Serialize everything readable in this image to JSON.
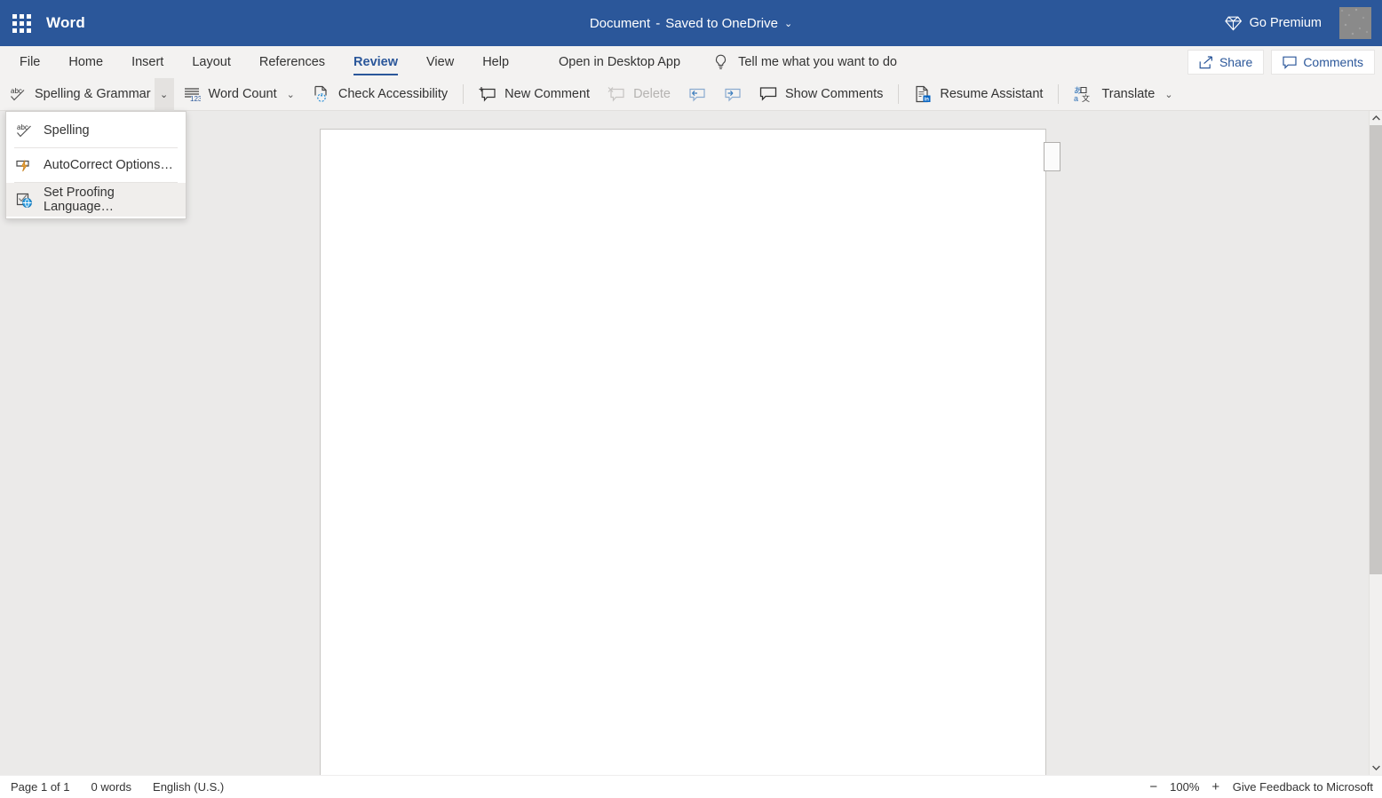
{
  "titlebar": {
    "app_name": "Word",
    "waffle_icon": "app-launcher-icon",
    "document_name": "Document",
    "separator": "-",
    "save_status": "Saved to OneDrive",
    "title_chevron": "⌄",
    "go_premium": "Go Premium",
    "premium_icon": "diamond-icon",
    "avatar_icon": "user-avatar",
    "brand_color": "#2b579a"
  },
  "tabs": [
    {
      "label": "File",
      "active": false
    },
    {
      "label": "Home",
      "active": false
    },
    {
      "label": "Insert",
      "active": false
    },
    {
      "label": "Layout",
      "active": false
    },
    {
      "label": "References",
      "active": false
    },
    {
      "label": "Review",
      "active": true
    },
    {
      "label": "View",
      "active": false
    },
    {
      "label": "Help",
      "active": false
    }
  ],
  "tabbar": {
    "open_desktop": "Open in Desktop App",
    "tellme_icon": "lightbulb-icon",
    "tellme": "Tell me what you want to do",
    "share_label": "Share",
    "share_icon": "share-icon",
    "comments_label": "Comments",
    "comments_icon": "comment-icon",
    "accent_color": "#2b579a"
  },
  "ribbon": {
    "items": [
      {
        "label": "Spelling & Grammar",
        "icon": "abc-check-icon",
        "disabled": false,
        "has_split": true
      },
      {
        "label": "Word Count",
        "icon": "word-count-icon",
        "disabled": false,
        "chevron": "⌄"
      },
      {
        "label": "Check Accessibility",
        "icon": "accessibility-icon",
        "disabled": false
      },
      {
        "label": "New Comment",
        "icon": "new-comment-icon",
        "disabled": false
      },
      {
        "label": "Delete",
        "icon": "delete-comment-icon",
        "disabled": true
      },
      {
        "label": "",
        "icon": "previous-comment-icon",
        "disabled": false
      },
      {
        "label": "",
        "icon": "next-comment-icon",
        "disabled": false
      },
      {
        "label": "Show Comments",
        "icon": "show-comments-icon",
        "disabled": false
      },
      {
        "label": "Resume Assistant",
        "icon": "resume-assistant-icon",
        "disabled": false
      },
      {
        "label": "Translate",
        "icon": "translate-icon",
        "disabled": false,
        "chevron": "⌄"
      }
    ],
    "split_chevron": "⌄"
  },
  "dropdown": {
    "visible": true,
    "items": [
      {
        "label": "Spelling",
        "icon": "abc-check-icon",
        "highlighted": false
      },
      {
        "label": "AutoCorrect Options…",
        "icon": "autocorrect-lightning-icon",
        "highlighted": false
      },
      {
        "label": "Set Proofing Language…",
        "icon": "proofing-language-globe-icon",
        "highlighted": true
      }
    ]
  },
  "canvas": {
    "page_background": "#ffffff",
    "canvas_background": "#ebeae9"
  },
  "scrollbar": {
    "up_arrow": "▲",
    "down_arrow": "▼"
  },
  "statusbar": {
    "page_info": "Page 1 of 1",
    "word_count": "0 words",
    "language": "English (U.S.)",
    "zoom_out": "−",
    "zoom_level": "100%",
    "zoom_in": "+",
    "feedback": "Give Feedback to Microsoft"
  }
}
